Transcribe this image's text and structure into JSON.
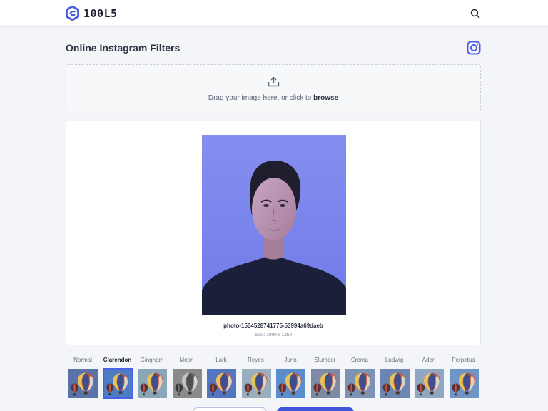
{
  "header": {
    "logo_text": "100L5",
    "brand_color": "#4a5ce0",
    "logo_icon": "hexagon-logo-icon",
    "search_icon": "search-icon"
  },
  "page": {
    "title": "Online Instagram Filters",
    "instagram_icon": "instagram-icon"
  },
  "dropzone": {
    "icon": "upload-icon",
    "text": "Drag your image here, or click to ",
    "link": "browse"
  },
  "preview": {
    "file_name": "photo-1534528741775-53994a69daeb",
    "size_text": "Size: 1000 x 1250"
  },
  "filters": {
    "selected": "Clarendon",
    "items": [
      {
        "label": "Normal"
      },
      {
        "label": "Clarendon"
      },
      {
        "label": "Gingham"
      },
      {
        "label": "Moon"
      },
      {
        "label": "Lark"
      },
      {
        "label": "Reyes"
      },
      {
        "label": "Juno"
      },
      {
        "label": "Slumber"
      },
      {
        "label": "Crema"
      },
      {
        "label": "Ludwig"
      },
      {
        "label": "Aden"
      },
      {
        "label": "Perpetua"
      }
    ]
  },
  "colors": {
    "accent": "#3f57d8",
    "background": "#f4f5f8",
    "photo_backdrop": "#7b86ee"
  }
}
